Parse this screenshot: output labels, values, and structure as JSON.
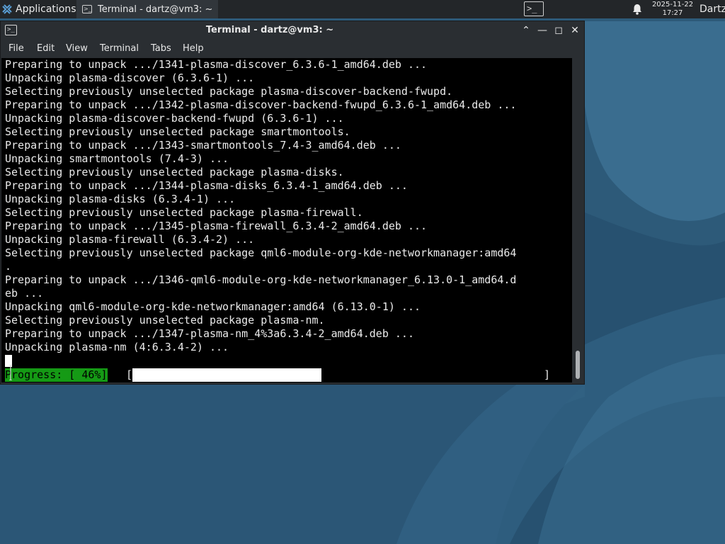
{
  "panel": {
    "applications_label": "Applications",
    "task_title": "Terminal - dartz@vm3: ~",
    "date": "2025-11-22",
    "time": "17:27",
    "user": "Dartz",
    "launcher_glyph": ">_",
    "task_icon_glyph": ">_",
    "icons": [
      "applications-icon",
      "terminal-task-icon",
      "terminal-launcher-icon",
      "notification-bell-icon"
    ]
  },
  "window": {
    "title": "Terminal - dartz@vm3: ~",
    "icon_glyph": ">_",
    "buttons": {
      "shade": "⌃",
      "minimize": "—",
      "maximize": "◻",
      "close": "✕"
    },
    "menu": [
      "File",
      "Edit",
      "View",
      "Terminal",
      "Tabs",
      "Help"
    ]
  },
  "terminal": {
    "lines": [
      "Preparing to unpack .../1341-plasma-discover_6.3.6-1_amd64.deb ...",
      "Unpacking plasma-discover (6.3.6-1) ...",
      "Selecting previously unselected package plasma-discover-backend-fwupd.",
      "Preparing to unpack .../1342-plasma-discover-backend-fwupd_6.3.6-1_amd64.deb ...",
      "Unpacking plasma-discover-backend-fwupd (6.3.6-1) ...",
      "Selecting previously unselected package smartmontools.",
      "Preparing to unpack .../1343-smartmontools_7.4-3_amd64.deb ...",
      "Unpacking smartmontools (7.4-3) ...",
      "Selecting previously unselected package plasma-disks.",
      "Preparing to unpack .../1344-plasma-disks_6.3.4-1_amd64.deb ...",
      "Unpacking plasma-disks (6.3.4-1) ...",
      "Selecting previously unselected package plasma-firewall.",
      "Preparing to unpack .../1345-plasma-firewall_6.3.4-2_amd64.deb ...",
      "Unpacking plasma-firewall (6.3.4-2) ...",
      "Selecting previously unselected package qml6-module-org-kde-networkmanager:amd64",
      ".",
      "Preparing to unpack .../1346-qml6-module-org-kde-networkmanager_6.13.0-1_amd64.d",
      "eb ...",
      "Unpacking qml6-module-org-kde-networkmanager:amd64 (6.13.0-1) ...",
      "Selecting previously unselected package plasma-nm.",
      "Preparing to unpack .../1347-plasma-nm_4%3a6.3.4-2_amd64.deb ...",
      "Unpacking plasma-nm (4:6.3.4-2) ..."
    ],
    "progress_label": "Progress: [ 46%]",
    "progress_fraction": 0.46,
    "bracket_open": "[",
    "bracket_close": "]"
  },
  "colors": {
    "panel_bg": "#232629",
    "window_bg": "#2a2e32",
    "terminal_bg": "#000000",
    "terminal_fg": "#eaeaea",
    "progress_label_bg": "#159a15",
    "desktop_bg": "#2c5878"
  }
}
